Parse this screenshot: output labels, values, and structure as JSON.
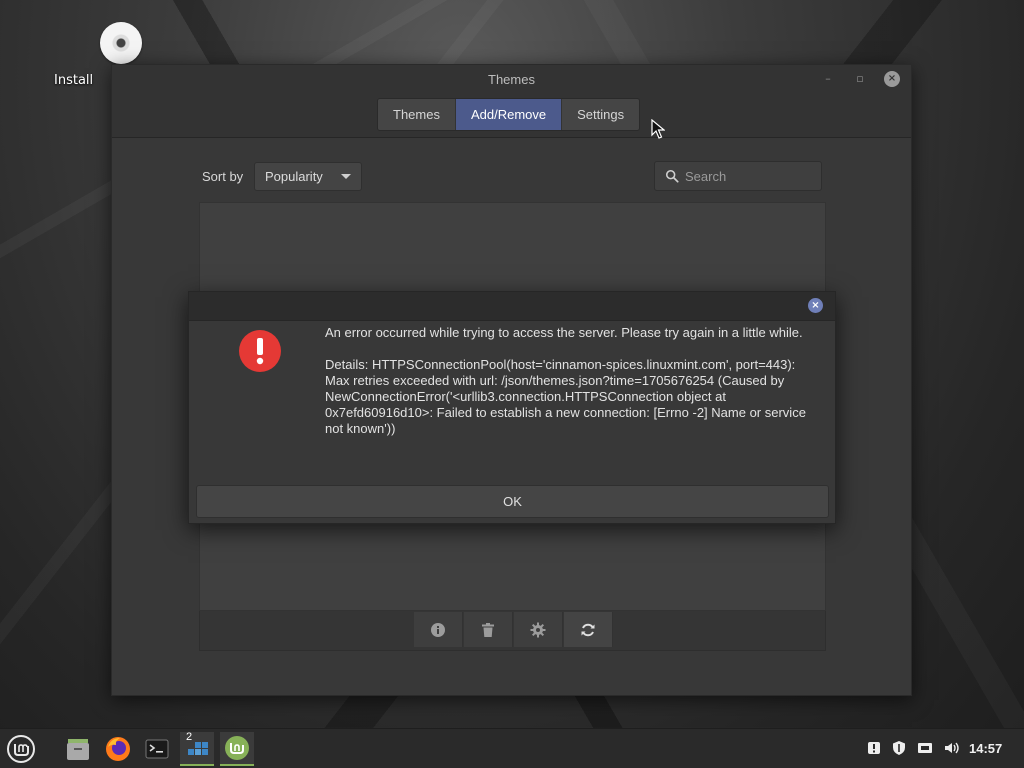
{
  "desktop": {
    "icons": [
      {
        "label": "Install",
        "icon": "disc-icon"
      }
    ]
  },
  "window": {
    "title": "Themes",
    "tabs": [
      {
        "label": "Themes",
        "active": false
      },
      {
        "label": "Add/Remove",
        "active": true
      },
      {
        "label": "Settings",
        "active": false
      }
    ],
    "sort": {
      "label": "Sort by",
      "value": "Popularity"
    },
    "search": {
      "placeholder": "Search",
      "value": ""
    },
    "toolbar": {
      "buttons": [
        "info-icon",
        "trash-icon",
        "gear-icon",
        "refresh-icon"
      ]
    }
  },
  "dialog": {
    "message": "An error occurred while trying to access the server. Please try again in a little while.",
    "details": "Details:  HTTPSConnectionPool(host='cinnamon-spices.linuxmint.com', port=443): Max retries exceeded with url: /json/themes.json?time=1705676254 (Caused by NewConnectionError('<urllib3.connection.HTTPSConnection object at 0x7efd60916d10>: Failed to establish a new connection: [Errno -2] Name or service not known'))",
    "ok_label": "OK",
    "accent": "#e53935"
  },
  "taskbar": {
    "workspace_number": "2",
    "clock": "14:57",
    "accent": "#87b158"
  }
}
